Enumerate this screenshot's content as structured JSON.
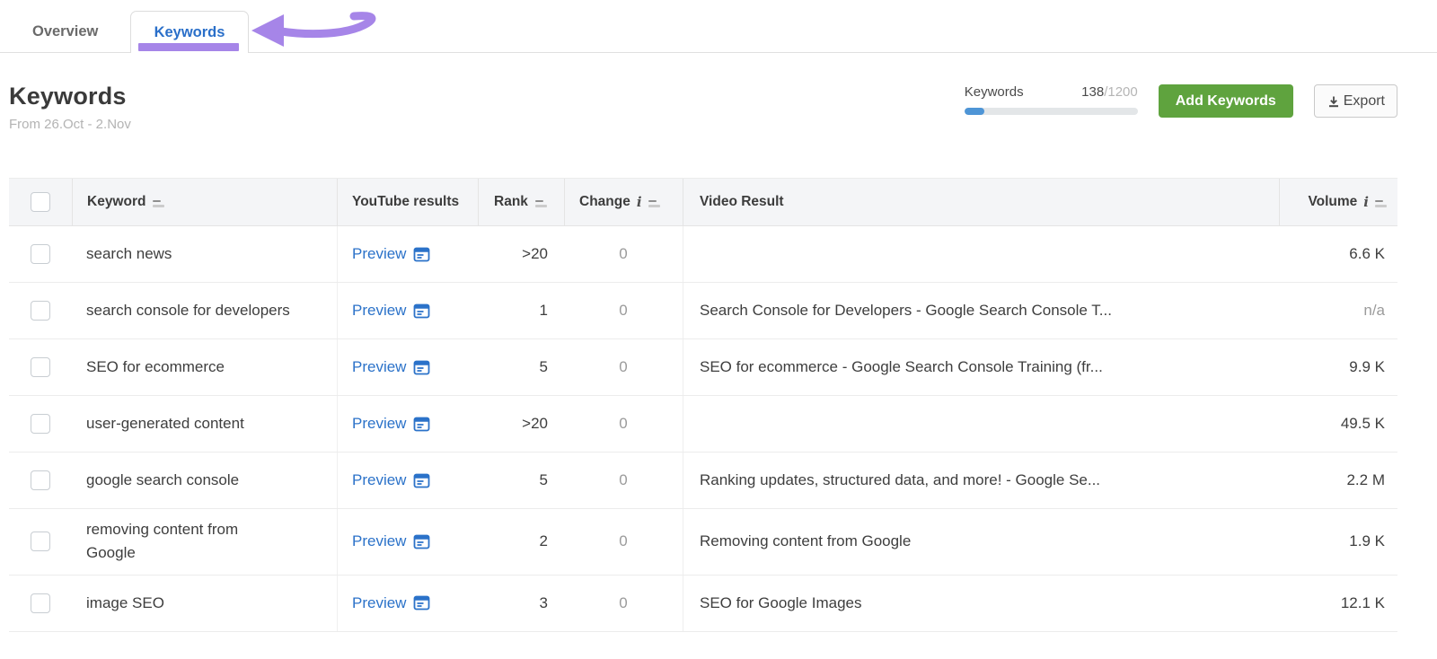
{
  "tabs": [
    {
      "label": "Overview",
      "active": false
    },
    {
      "label": "Keywords",
      "active": true
    }
  ],
  "header": {
    "title": "Keywords",
    "date_range": "From 26.Oct - 2.Nov",
    "limit": {
      "label": "Keywords",
      "used": "138",
      "total": "/1200",
      "percent": 11.5
    },
    "add_button_label": "Add Keywords",
    "export_button_label": "Export"
  },
  "table": {
    "columns": {
      "keyword": "Keyword",
      "youtube_results": "YouTube results",
      "rank": "Rank",
      "change": "Change",
      "video_result": "Video Result",
      "volume": "Volume"
    },
    "preview_label": "Preview",
    "rows": [
      {
        "keyword": "search news",
        "rank": ">20",
        "change": "0",
        "video_result": "",
        "volume": "6.6 K"
      },
      {
        "keyword": "search console for developers",
        "rank": "1",
        "change": "0",
        "video_result": "Search Console for Developers - Google Search Console T...",
        "volume": "n/a"
      },
      {
        "keyword": "SEO for ecommerce",
        "rank": "5",
        "change": "0",
        "video_result": "SEO for ecommerce - Google Search Console Training (fr...",
        "volume": "9.9 K"
      },
      {
        "keyword": "user-generated content",
        "rank": ">20",
        "change": "0",
        "video_result": "",
        "volume": "49.5 K"
      },
      {
        "keyword": "google search console",
        "rank": "5",
        "change": "0",
        "video_result": "Ranking updates, structured data, and more! - Google Se...",
        "volume": "2.2 M"
      },
      {
        "keyword": "removing content from\nGoogle",
        "rank": "2",
        "change": "0",
        "video_result": "Removing content from Google",
        "volume": "1.9 K"
      },
      {
        "keyword": "image SEO",
        "rank": "3",
        "change": "0",
        "video_result": "SEO for Google Images",
        "volume": "12.1 K"
      }
    ]
  },
  "colors": {
    "accent_purple": "#a685e8",
    "active_tab_blue": "#2a6fc9",
    "link_blue": "#2b72c9",
    "button_green": "#5fa33e",
    "progress_blue": "#4e95d6"
  }
}
